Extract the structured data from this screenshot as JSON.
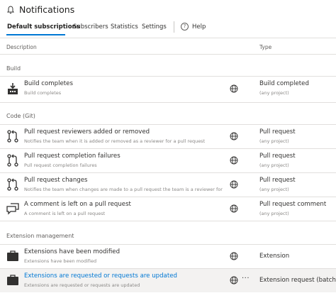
{
  "header": {
    "title": "Notifications",
    "icon": "bell-icon"
  },
  "tabs": [
    {
      "label": "Default subscriptions",
      "active": true
    },
    {
      "label": "Subscribers"
    },
    {
      "label": "Statistics"
    },
    {
      "label": "Settings"
    },
    {
      "label": "Help"
    }
  ],
  "columns": {
    "description": "Description",
    "type": "Type"
  },
  "groups": {
    "build": "Build",
    "code": "Code (Git)",
    "extension": "Extension management"
  },
  "rows": [
    {
      "title": "Build completes",
      "desc": "Build completes",
      "type": "Build completed",
      "scope": "(any project)",
      "icon": "build-icon"
    },
    {
      "title": "Pull request reviewers added or removed",
      "desc": "Notifies the team when it is added or removed as a reviewer for a pull request",
      "type": "Pull request",
      "scope": "(any project)",
      "icon": "pull-request-icon"
    },
    {
      "title": "Pull request completion failures",
      "desc": "Pull request completion failures",
      "type": "Pull request",
      "scope": "(any project)",
      "icon": "pull-request-icon"
    },
    {
      "title": "Pull request changes",
      "desc": "Notifies the team when changes are made to a pull request the team is a reviewer for",
      "type": "Pull request",
      "scope": "(any project)",
      "icon": "pull-request-icon"
    },
    {
      "title": "A comment is left on a pull request",
      "desc": "A comment is left on a pull request",
      "type": "Pull request comment",
      "scope": "(any project)",
      "icon": "comment-icon"
    },
    {
      "title": "Extensions have been modified",
      "desc": "Extensions have been modified",
      "type": "Extension",
      "scope": "",
      "icon": "briefcase-icon"
    },
    {
      "title": "Extensions are requested or requests are updated",
      "desc": "Extensions are requested or requests are updated",
      "type": "Extension request (batch)",
      "scope": "",
      "icon": "briefcase-icon",
      "more": "···"
    }
  ],
  "colors": {
    "accent": "#0078d4",
    "text": "#323130",
    "muted": "#8a8886",
    "divider": "#e1dfdd"
  }
}
